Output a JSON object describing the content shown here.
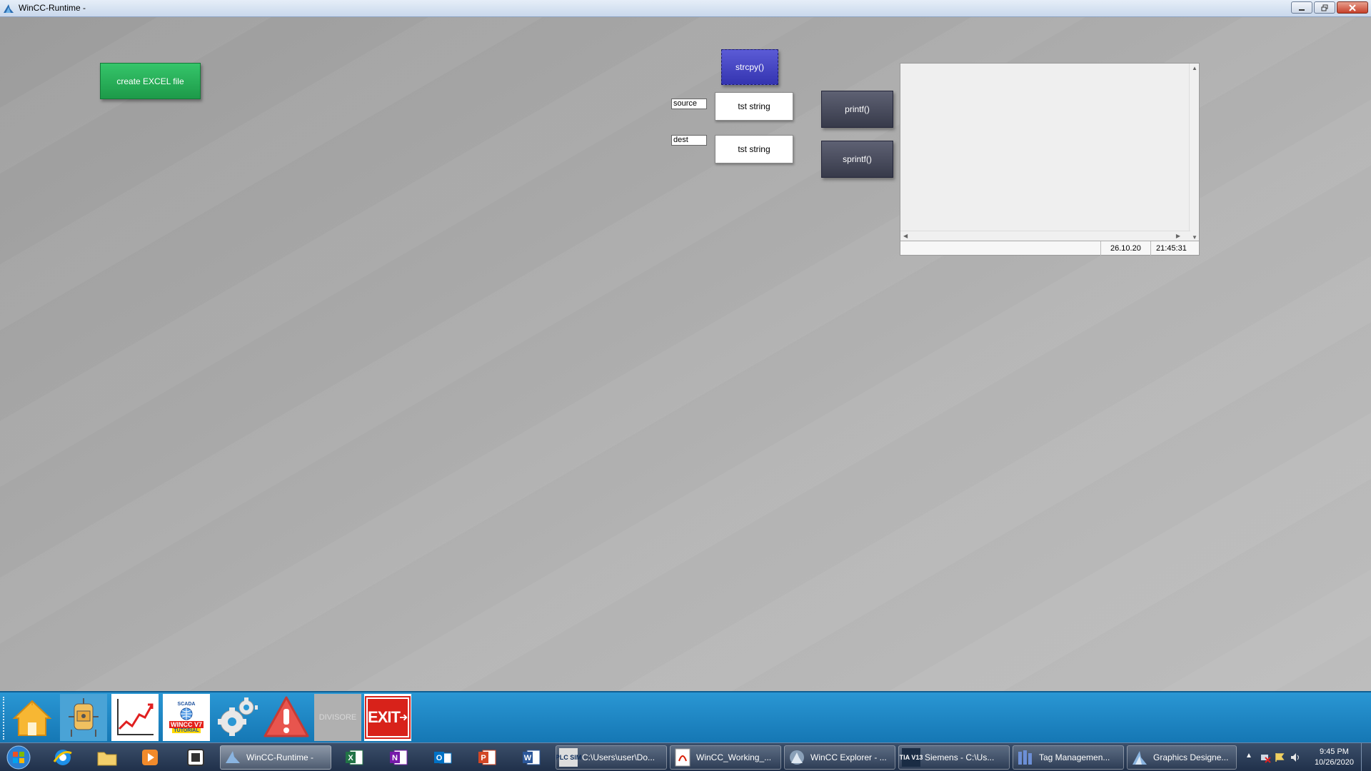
{
  "window": {
    "title": "WinCC-Runtime -",
    "controls": [
      "minimize",
      "restore",
      "close"
    ]
  },
  "screen": {
    "excel_button": "create EXCEL file",
    "strcpy_button": "strcpy()",
    "source_label": "source",
    "dest_label": "dest",
    "source_value": "tst string",
    "dest_value": "tst string",
    "printf_button": "printf()",
    "sprintf_button": "sprintf()",
    "output_panel": {
      "date": "26.10.20",
      "time": "21:45:31"
    }
  },
  "navbar": {
    "items": [
      {
        "name": "home",
        "icon": "house-icon"
      },
      {
        "name": "plant",
        "icon": "tank-icon"
      },
      {
        "name": "trends",
        "icon": "trend-chart-icon"
      },
      {
        "name": "scada-logo",
        "icon": "scada-wincc-logo",
        "text_top": "SCADA",
        "text_mid": "WINCC V7",
        "text_bot": "TUTORIAL"
      },
      {
        "name": "settings",
        "icon": "gears-icon"
      },
      {
        "name": "alarms",
        "icon": "warning-icon"
      },
      {
        "name": "divisore",
        "label": "DIVISORE"
      },
      {
        "name": "exit",
        "label": "EXIT"
      }
    ]
  },
  "taskbar": {
    "tasks": [
      {
        "label": "WinCC-Runtime -",
        "icon": "wincc-icon",
        "active": true
      },
      {
        "label": "C:\\Users\\user\\Do...",
        "icon": "plcsim-icon",
        "icon_text": "PLC SIM"
      },
      {
        "label": "WinCC_Working_...",
        "icon": "pdf-icon"
      },
      {
        "label": "WinCC Explorer - ...",
        "icon": "wincc-explorer-icon"
      },
      {
        "label": "Siemens  -  C:\\Us...",
        "icon": "tia-icon",
        "icon_text": "TIA V13"
      },
      {
        "label": "Tag Managemen...",
        "icon": "tag-management-icon"
      },
      {
        "label": "Graphics Designe...",
        "icon": "graphics-designer-icon"
      }
    ],
    "clock_time": "9:45 PM",
    "clock_date": "10/26/2020"
  }
}
